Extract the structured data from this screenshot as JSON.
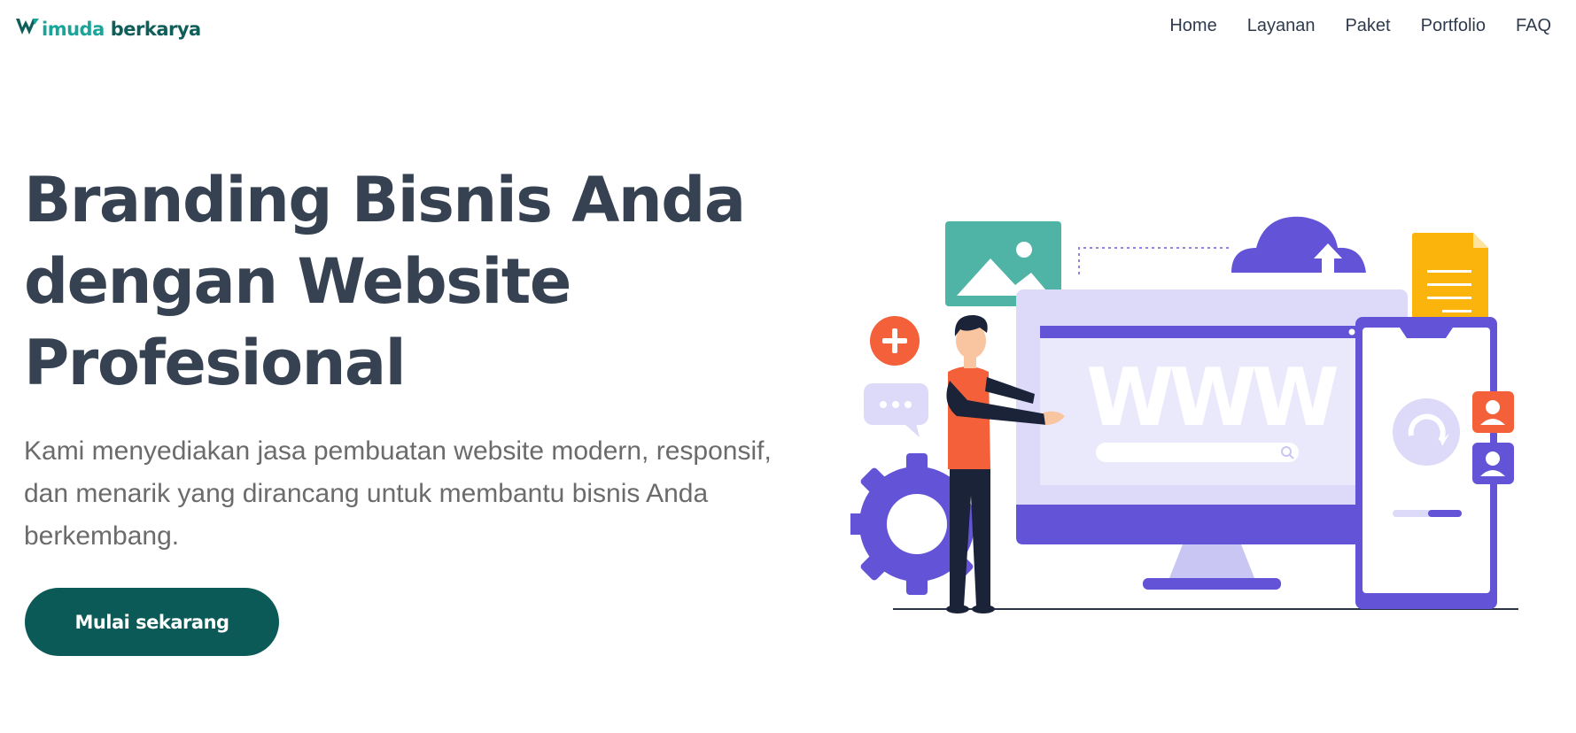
{
  "brand": {
    "name_part1": "imuda",
    "name_part2": "berkarya",
    "logo_icon": "w-chevron-logo-icon"
  },
  "nav": {
    "items": [
      {
        "label": "Home"
      },
      {
        "label": "Layanan"
      },
      {
        "label": "Paket"
      },
      {
        "label": "Portfolio"
      },
      {
        "label": "FAQ"
      }
    ]
  },
  "hero": {
    "title_line1": "Branding Bisnis Anda",
    "title_line2": "dengan Website",
    "title_line3": "Profesional",
    "description": "Kami menyediakan jasa pembuatan website modern, responsif, dan menarik yang dirancang untuk membantu bisnis Anda berkembang.",
    "cta_label": "Mulai sekarang"
  },
  "illustration": {
    "monitor_text": "WWW",
    "icons": [
      "image-icon",
      "cloud-upload-icon",
      "document-icon",
      "plus-icon",
      "chat-bubble-icon",
      "gear-icon",
      "search-icon",
      "refresh-icon",
      "user-icon"
    ]
  },
  "colors": {
    "primary": "#0b5a57",
    "brand_teal": "#1aa59a",
    "heading": "#364152",
    "body_text": "#6b6b6b",
    "illustration_purple": "#6353d6",
    "illustration_light_purple": "#dcdaf8",
    "illustration_orange": "#f4603a",
    "illustration_yellow": "#fbb40c",
    "illustration_teal": "#4fb3a6"
  }
}
